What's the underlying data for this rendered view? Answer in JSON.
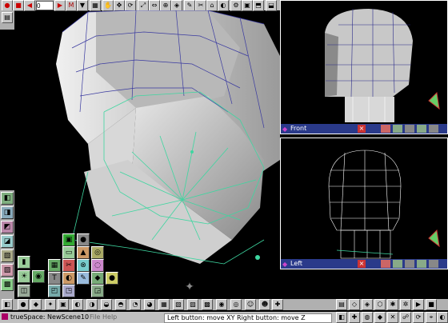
{
  "frame_field": {
    "value": "0"
  },
  "viewports": [
    {
      "title": "Front"
    },
    {
      "title": "Left"
    }
  ],
  "taskbar": {
    "app_title": "trueSpace: NewScene10",
    "menu": [
      "File",
      "Help"
    ],
    "status_text": "Left button: move XY  Right button: move Z"
  },
  "colors": {
    "background": "#000000",
    "toolbar": "#c0c0c0",
    "viewport_title": "#2a3a8a",
    "wire": "#3a3aa0",
    "selection": "#3ed6a0"
  }
}
